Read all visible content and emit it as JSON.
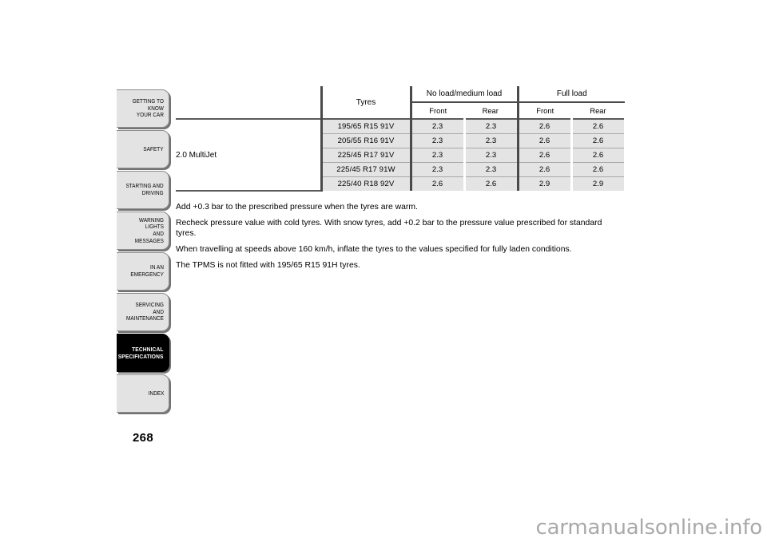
{
  "sidebar": {
    "items": [
      {
        "label": "GETTING TO KNOW\nYOUR CAR",
        "name": "getting-to-know-your-car",
        "active": false
      },
      {
        "label": "SAFETY",
        "name": "safety",
        "active": false
      },
      {
        "label": "STARTING AND\nDRIVING",
        "name": "starting-and-driving",
        "active": false
      },
      {
        "label": "WARNING LIGHTS\nAND MESSAGES",
        "name": "warning-lights-and-messages",
        "active": false
      },
      {
        "label": "IN AN EMERGENCY",
        "name": "in-an-emergency",
        "active": false
      },
      {
        "label": "SERVICING AND\nMAINTENANCE",
        "name": "servicing-and-maintenance",
        "active": false
      },
      {
        "label": "TECHNICAL\nSPECIFICATIONS",
        "name": "technical-specifications",
        "active": true
      },
      {
        "label": "INDEX",
        "name": "index",
        "active": false
      }
    ]
  },
  "page": {
    "number": "268",
    "watermark": "carmanualsonline.info"
  },
  "table": {
    "engine_label": "2.0 MultiJet",
    "headers": {
      "tyres": "Tyres",
      "group_no_load": "No load/medium load",
      "group_full_load": "Full load",
      "front": "Front",
      "rear": "Rear"
    },
    "rows": [
      {
        "tyre": "195/65 R15 91V",
        "nl_front": "2.3",
        "nl_rear": "2.3",
        "fl_front": "2.6",
        "fl_rear": "2.6"
      },
      {
        "tyre": "205/55 R16 91V",
        "nl_front": "2.3",
        "nl_rear": "2.3",
        "fl_front": "2.6",
        "fl_rear": "2.6"
      },
      {
        "tyre": "225/45 R17 91V",
        "nl_front": "2.3",
        "nl_rear": "2.3",
        "fl_front": "2.6",
        "fl_rear": "2.6"
      },
      {
        "tyre": "225/45 R17 91W",
        "nl_front": "2.3",
        "nl_rear": "2.3",
        "fl_front": "2.6",
        "fl_rear": "2.6"
      },
      {
        "tyre": "225/40 R18 92V",
        "nl_front": "2.6",
        "nl_rear": "2.6",
        "fl_front": "2.9",
        "fl_rear": "2.9"
      }
    ]
  },
  "notes": [
    "Add +0.3 bar to the prescribed pressure when the tyres are warm.",
    "Recheck pressure value with cold tyres. With snow tyres, add +0.2 bar to the pressure value prescribed for standard tyres.",
    "When travelling at speeds above 160 km/h, inflate the tyres to the values specified for fully laden conditions.",
    "The TPMS is not fitted with 195/65 R15 91H tyres."
  ],
  "colors": {
    "tab_background": "#e3e3e3",
    "tab_active_background": "#000000",
    "cell_background": "#e4e4e4",
    "rule": "#4a4a4a",
    "watermark": "#a9a9a9"
  }
}
